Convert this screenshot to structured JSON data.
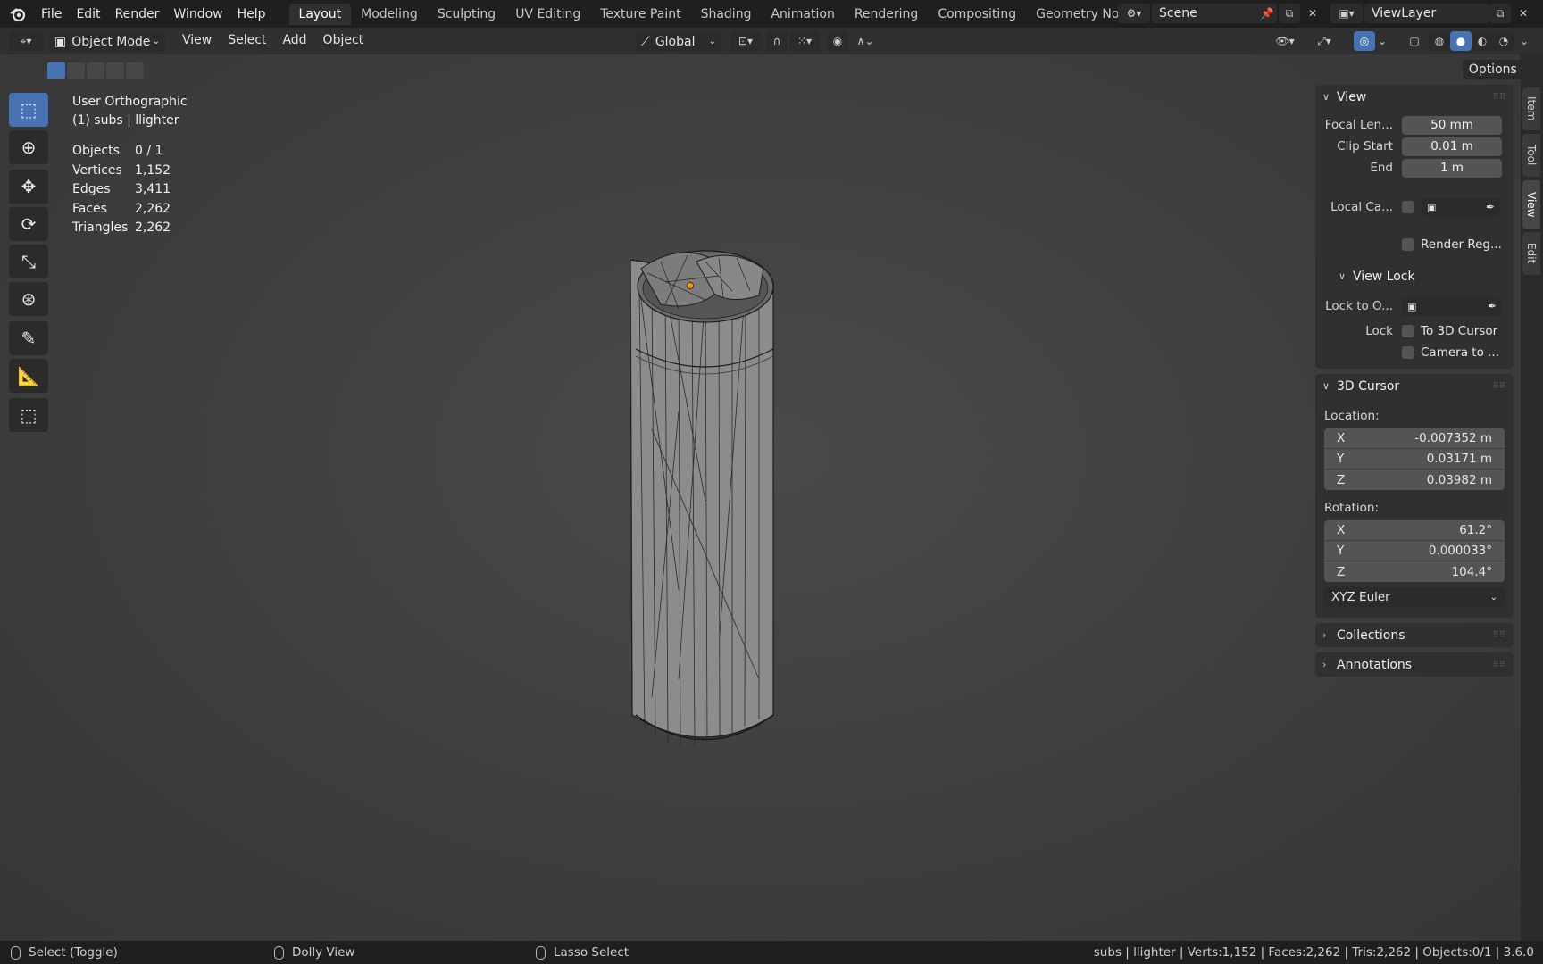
{
  "topbar": {
    "menus": [
      "File",
      "Edit",
      "Render",
      "Window",
      "Help"
    ],
    "workspaces": [
      "Layout",
      "Modeling",
      "Sculpting",
      "UV Editing",
      "Texture Paint",
      "Shading",
      "Animation",
      "Rendering",
      "Compositing",
      "Geometry Nodes"
    ],
    "active_workspace": "Layout",
    "scene": "Scene",
    "view_layer": "ViewLayer"
  },
  "header": {
    "mode": "Object Mode",
    "menus": [
      "View",
      "Select",
      "Add",
      "Object"
    ],
    "orientation": "Global",
    "options_label": "Options"
  },
  "overlay": {
    "view_name": "User Orthographic",
    "object_info": "(1) subs | llighter",
    "stats": [
      {
        "label": "Objects",
        "value": "0 / 1"
      },
      {
        "label": "Vertices",
        "value": "1,152"
      },
      {
        "label": "Edges",
        "value": "3,411"
      },
      {
        "label": "Faces",
        "value": "2,262"
      },
      {
        "label": "Triangles",
        "value": "2,262"
      }
    ]
  },
  "sidebar_tabs": [
    "Item",
    "Tool",
    "View",
    "Edit"
  ],
  "active_sidebar_tab": "View",
  "npanel": {
    "view": {
      "title": "View",
      "focal_label": "Focal Len...",
      "focal_value": "50 mm",
      "clip_start_label": "Clip Start",
      "clip_start_value": "0.01 m",
      "end_label": "End",
      "end_value": "1 m",
      "local_camera_label": "Local Ca...",
      "render_region_label": "Render Reg..."
    },
    "view_lock": {
      "title": "View Lock",
      "lock_to_label": "Lock to O...",
      "lock_label": "Lock",
      "to_cursor_label": "To 3D Cursor",
      "camera_to_label": "Camera to ..."
    },
    "cursor": {
      "title": "3D Cursor",
      "location_label": "Location:",
      "location": [
        {
          "axis": "X",
          "value": "-0.007352 m"
        },
        {
          "axis": "Y",
          "value": "0.03171 m"
        },
        {
          "axis": "Z",
          "value": "0.03982 m"
        }
      ],
      "rotation_label": "Rotation:",
      "rotation": [
        {
          "axis": "X",
          "value": "61.2°"
        },
        {
          "axis": "Y",
          "value": "0.000033°"
        },
        {
          "axis": "Z",
          "value": "104.4°"
        }
      ],
      "rotation_mode": "XYZ Euler"
    },
    "collections_title": "Collections",
    "annotations_title": "Annotations"
  },
  "statusbar": {
    "left_action": "Select (Toggle)",
    "middle_action": "Dolly View",
    "right_action": "Lasso Select",
    "info": "subs | llighter | Verts:1,152 | Faces:2,262 | Tris:2,262 | Objects:0/1 | 3.6.0"
  },
  "colors": {
    "accent": "#4772b3",
    "panel": "#303030",
    "viewport": "#3e3e3e",
    "field": "#545454",
    "origin": "#ff9c00"
  }
}
